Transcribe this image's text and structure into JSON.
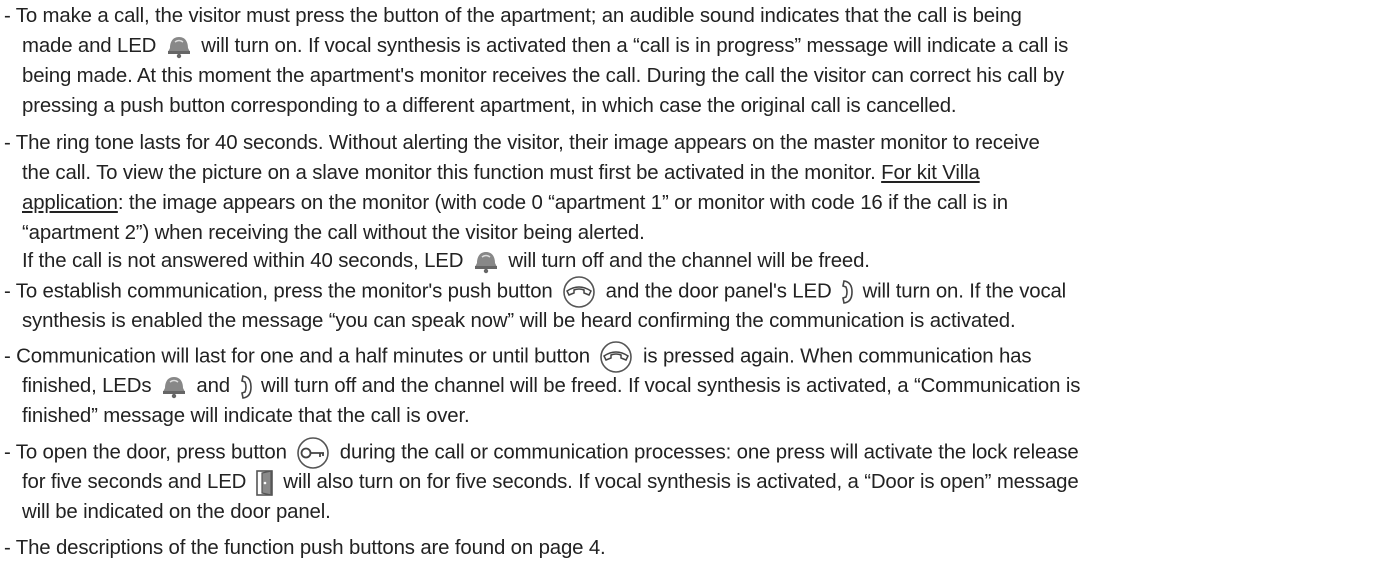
{
  "doc": {
    "p1": {
      "l1": "- To make a call, the visitor must press the button of the apartment; an audible sound indicates that the call is being",
      "l2a": "made and LED",
      "l2b": "will turn on. If vocal synthesis is activated then a “call is in progress” message will indicate a call is",
      "l3": "being made. At this moment the apartment's monitor receives the call. During the call the visitor can correct his call by",
      "l4": "pressing a push button corresponding to a different apartment, in which case the original call is cancelled."
    },
    "p2": {
      "l1": "- The ring tone lasts for 40 seconds. Without alerting the visitor, their image appears on the master monitor to receive",
      "l2a": "the call. To view the picture on a slave monitor this function must first be activated in the monitor.",
      "l2b": "For kit Villa",
      "l3a": "application",
      "l3b": ": the image appears on the monitor (with code 0 “apartment 1” or monitor with code 16 if the call is in",
      "l4": "“apartment 2”) when receiving the call without the visitor being alerted.",
      "l5a": "If the call is not answered within 40 seconds, LED",
      "l5b": "will turn off and the channel will be freed."
    },
    "p3": {
      "l1a": "- To establish communication, press the monitor's push button",
      "l1b": "and the door panel's LED",
      "l1c": "will turn on. If the vocal",
      "l2": "synthesis is enabled the message “you can speak now” will be heard confirming the communication is activated."
    },
    "p4": {
      "l1a": "- Communication will last for one and a half minutes or until button",
      "l1b": "is pressed again. When communication has",
      "l2a": "finished, LEDs",
      "l2b": "and",
      "l2c": "will turn off and the channel will be freed. If vocal synthesis is activated, a “Communication is",
      "l3": "finished” message will indicate that the call is over."
    },
    "p5": {
      "l1a": "- To open the door, press button",
      "l1b": "during the call or communication processes: one press will activate the lock release",
      "l2a": "for five seconds and LED",
      "l2b": "will also turn on for five seconds. If vocal synthesis is activated, a “Door is open” message",
      "l3": "will be indicated on the door panel."
    },
    "p6": {
      "l1": "- The descriptions of the function push buttons are found on page 4."
    }
  },
  "icons": {
    "call": "bell-icon",
    "speak": "handset-icon",
    "talk_button": "handset-button-icon",
    "key_button": "key-button-icon",
    "door": "door-icon"
  }
}
